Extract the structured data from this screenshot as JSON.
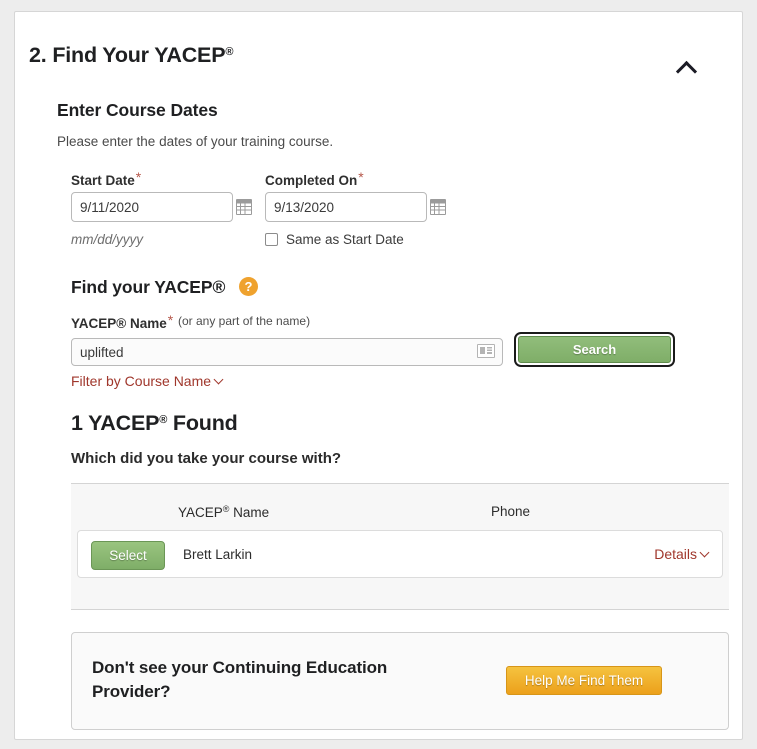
{
  "section": {
    "number": "2.",
    "title": "Find Your YACEP",
    "title_superscript": "®",
    "collapse_icon": "chevron-up-icon"
  },
  "dates": {
    "heading": "Enter Course Dates",
    "helper": "Please enter the dates of your training course.",
    "start_label": "Start Date",
    "start_required_mark": "*",
    "start_value": "9/11/2020",
    "start_format_hint": "mm/dd/yyyy",
    "completed_label": "Completed On",
    "completed_required_mark": "*",
    "completed_value": "9/13/2020",
    "same_as_start_label": "Same as Start Date",
    "same_as_start_checked": false,
    "calendar_icon": "calendar-icon"
  },
  "find": {
    "heading": "Find your YACEP",
    "heading_superscript": "®",
    "help_badge": "?",
    "name_label": "YACEP",
    "name_label_superscript": "®",
    "name_label_tail": " Name",
    "name_required_mark": "*",
    "name_hint": "(or any part of the name)",
    "name_value": "uplifted",
    "name_placeholder": "",
    "input_icon": "contact-card-icon",
    "search_label": "Search",
    "filter_link": "Filter by Course Name",
    "filter_chevron": "chevron-down-icon"
  },
  "results": {
    "found_count": "1",
    "found_label_lead": "1 YACEP",
    "found_superscript": "®",
    "found_label_tail": " Found",
    "subheading": "Which did you take your course with?",
    "columns": [
      "YACEP® Name",
      "Phone"
    ],
    "col_name": "YACEP",
    "col_name_superscript": "®",
    "col_name_tail": " Name",
    "col_phone": "Phone",
    "rows": [
      {
        "select_label": "Select",
        "name": "Brett Larkin",
        "phone": "",
        "details_label": "Details",
        "details_chevron": "chevron-down-icon"
      }
    ]
  },
  "promo": {
    "text": "Don't see your Continuing Education Provider?",
    "button_label": "Help Me Find Them"
  },
  "colors": {
    "accent_green": "#7fae68",
    "accent_orange": "#efa22e",
    "link_red": "#a0372c",
    "required_red": "#b5574a",
    "heading_dark": "#1f2022",
    "page_bg": "#ededed",
    "table_bg": "#f7f7f7"
  }
}
